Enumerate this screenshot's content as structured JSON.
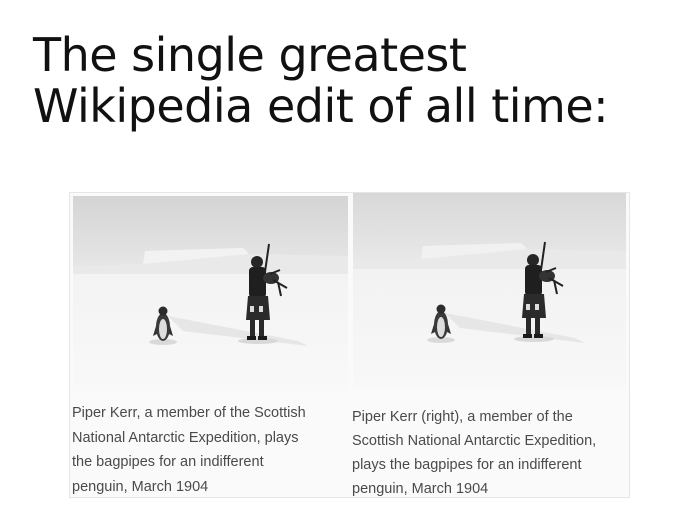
{
  "headline": {
    "lines": [
      "The single greatest",
      "Wikipedia edit of all time:"
    ]
  },
  "comparison": {
    "before": {
      "caption_lines": [
        "Piper Kerr, a member of the Scottish",
        "National Antarctic Expedition, plays",
        "the bagpipes for an indifferent",
        "penguin, March 1904"
      ]
    },
    "after": {
      "caption_lines": [
        "Piper Kerr (right), a member of the",
        "Scottish National Antarctic Expedition,",
        "plays the bagpipes for an indifferent",
        "penguin, March 1904"
      ]
    }
  }
}
